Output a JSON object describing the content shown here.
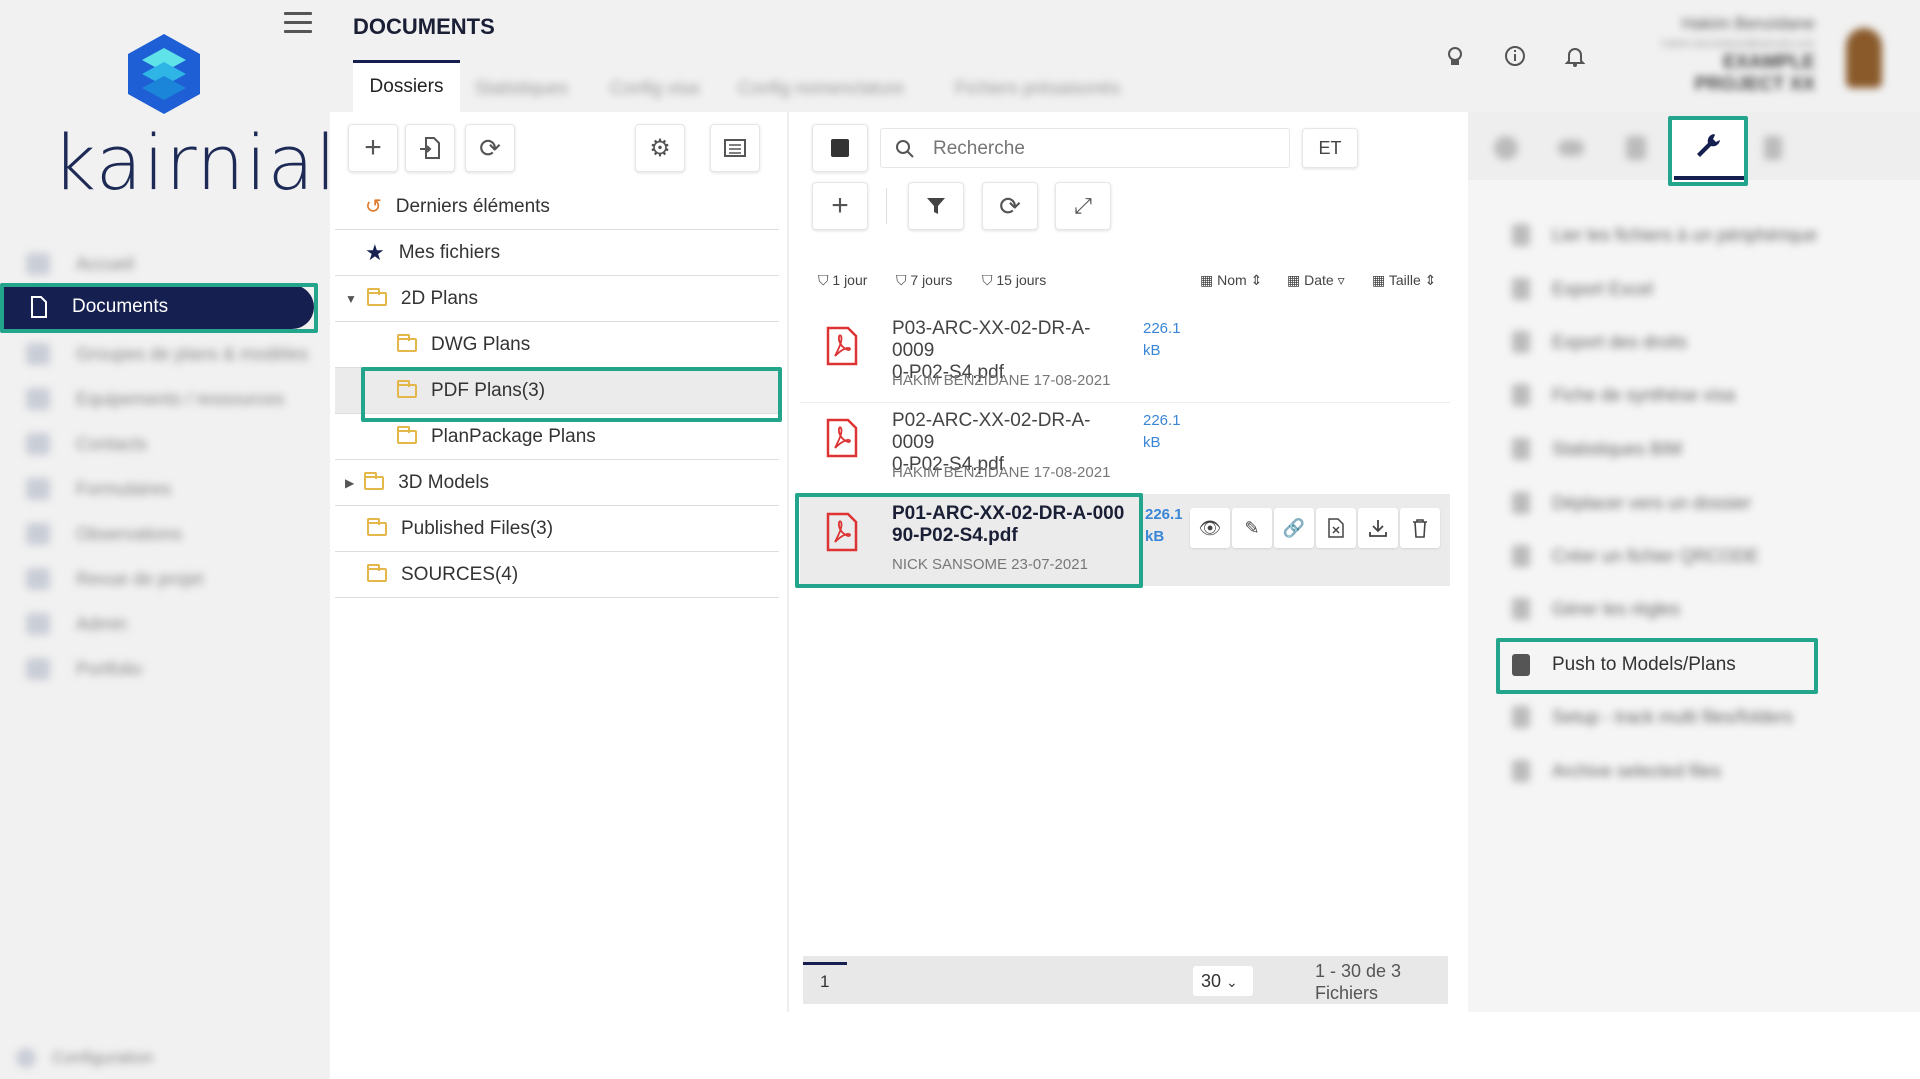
{
  "app": {
    "logo_text": "kairnial",
    "brand_color": "#152050",
    "accent_color": "#22a58a"
  },
  "sidebar": {
    "items": [
      {
        "label": "Accueil",
        "icon": "home-icon"
      },
      {
        "label": "Documents",
        "icon": "document-icon",
        "active": true
      },
      {
        "label": "Groupes de plans & modèles",
        "icon": "monitor-icon"
      },
      {
        "label": "Equipements / ressources",
        "icon": "equipment-icon"
      },
      {
        "label": "Contacts",
        "icon": "contacts-icon"
      },
      {
        "label": "Formulaires",
        "icon": "forms-icon"
      },
      {
        "label": "Observations",
        "icon": "observations-icon"
      },
      {
        "label": "Revue de projet",
        "icon": "review-icon"
      },
      {
        "label": "Admin",
        "icon": "admin-icon"
      },
      {
        "label": "Portfolio",
        "icon": "portfolio-icon"
      }
    ],
    "footer": "Configuration"
  },
  "header": {
    "title": "DOCUMENTS",
    "tabs": [
      "Dossiers",
      "Statistiques",
      "Config visa",
      "Config nomenclature",
      "Fichiers présaisonés"
    ],
    "user_name": "Hakim Benzidane",
    "user_email": "hakim.benzidane@kairnial.com",
    "project_line1": "EXAMPLE",
    "project_line2": "PROJECT XX"
  },
  "folders": {
    "items": [
      {
        "label": "Derniers éléments",
        "icon": "history-icon",
        "level": 0
      },
      {
        "label": "Mes fichiers",
        "icon": "star-icon",
        "level": 0
      },
      {
        "label": "2D Plans",
        "icon": "folder-icon",
        "level": 0,
        "expanded": true
      },
      {
        "label": "DWG Plans",
        "icon": "folder-icon",
        "level": 1
      },
      {
        "label": "PDF Plans(3)",
        "icon": "folder-icon",
        "level": 1,
        "selected": true
      },
      {
        "label": "PlanPackage Plans",
        "icon": "folder-icon",
        "level": 1
      },
      {
        "label": "3D Models",
        "icon": "folder-icon",
        "level": 0,
        "collapsed": true
      },
      {
        "label": "Published Files(3)",
        "icon": "folder-icon",
        "level": 0
      },
      {
        "label": "SOURCES(4)",
        "icon": "folder-icon",
        "level": 0
      }
    ]
  },
  "files": {
    "search_placeholder": "Recherche",
    "operator": "ET",
    "quick_filters": [
      "1 jour",
      "7 jours",
      "15 jours"
    ],
    "sort": [
      "Nom",
      "Date",
      "Taille"
    ],
    "rows": [
      {
        "name_line1": "P03-ARC-XX-02-DR-A-0009",
        "name_line2": "0-P02-S4.pdf",
        "author": "HAKIM BENZIDANE 17-08-2021",
        "size_value": "226.1",
        "size_unit": "kB"
      },
      {
        "name_line1": "P02-ARC-XX-02-DR-A-0009",
        "name_line2": "0-P02-S4.pdf",
        "author": "HAKIM BENZIDANE 17-08-2021",
        "size_value": "226.1",
        "size_unit": "kB"
      },
      {
        "name_line1": "P01-ARC-XX-02-DR-A-000",
        "name_line2": "90-P02-S4.pdf",
        "author": "NICK SANSOME 23-07-2021",
        "size_value": "226.1",
        "size_unit": "kB",
        "selected": true
      }
    ],
    "pager": {
      "page": "1",
      "per_page": "30",
      "range_line1": "1 - 30 de 3",
      "range_line2": "Fichiers"
    }
  },
  "tools": {
    "items": [
      "Lier les fichiers à un périphérique",
      "Export Excel",
      "Export des droits",
      "Fiche de synthèse visa",
      "Statistiques BIM",
      "Déplacer vers un dossier",
      "Créer un fichier QRCODE",
      "Gérer les règles",
      "Push to Models/Plans",
      "Setup - track multi files/folders",
      "Archive selected files"
    ],
    "highlighted": "Push to Models/Plans"
  }
}
